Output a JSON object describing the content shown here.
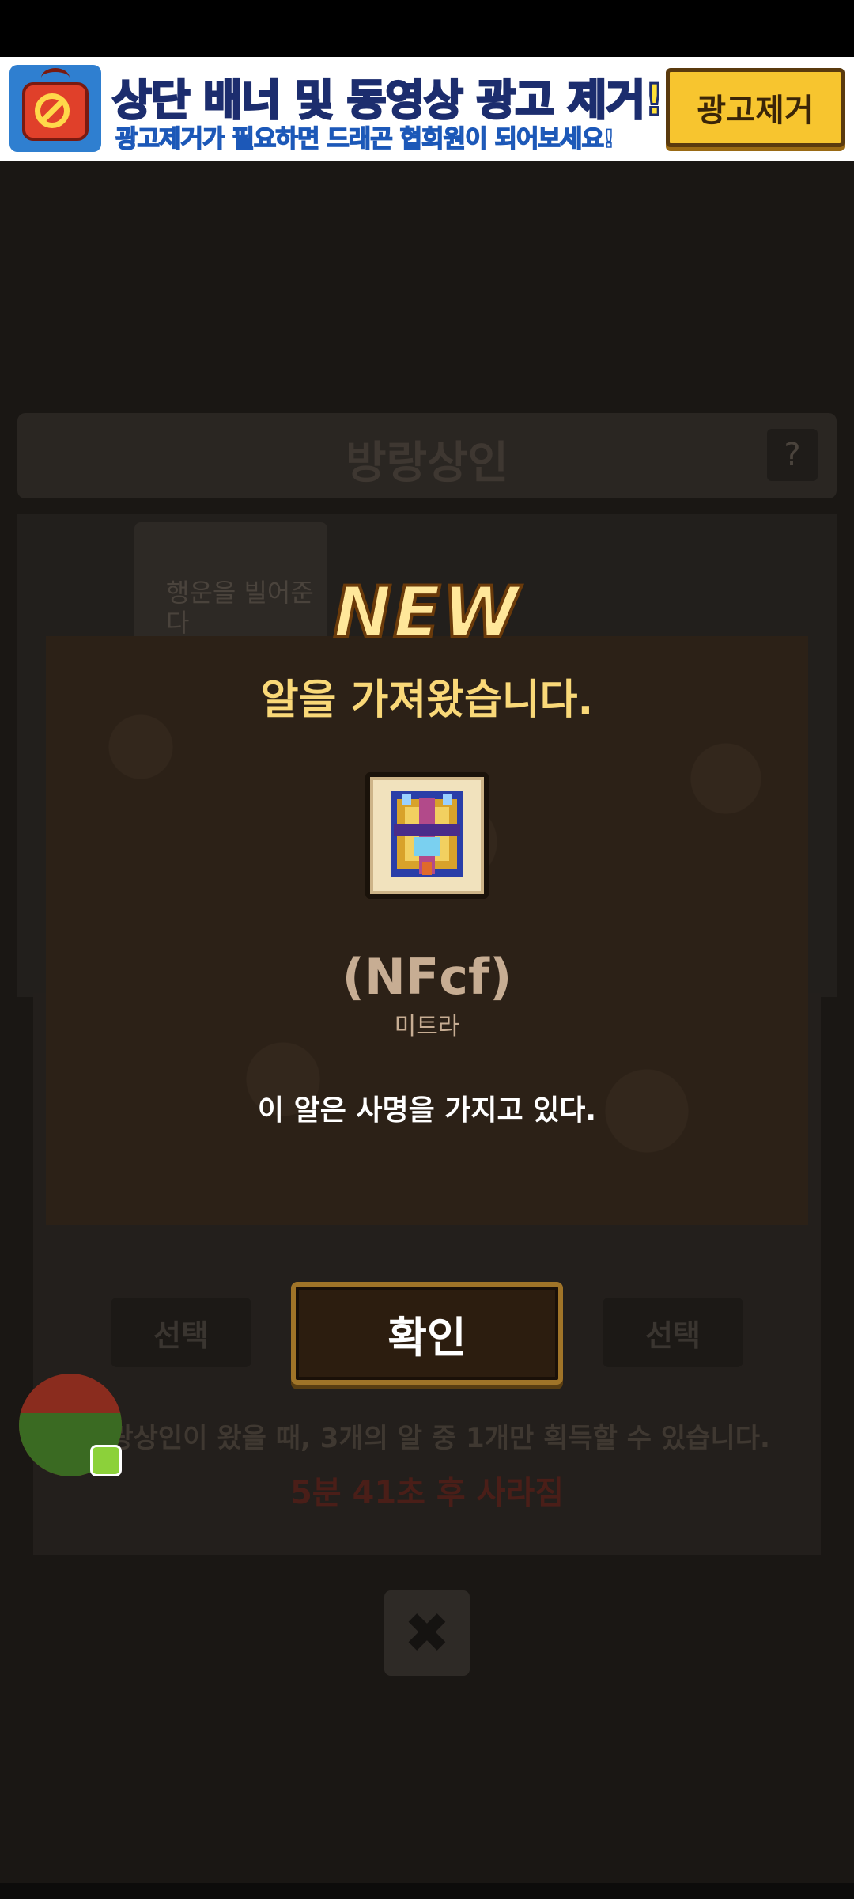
{
  "ad_banner": {
    "title": "상단 배너 및 동영상 광고 제거!",
    "subtitle": "광고제거가 필요하면 드래곤 협회원이 되어보세요!",
    "remove_button": "광고제거"
  },
  "background": {
    "header_title": "방랑상인",
    "help_label": "?",
    "card_text": "행운을 빌어준다",
    "select_left": "선택",
    "select_right": "선택",
    "info_text": "방랑상인이 왔을 때, 3개의 알 중 1개만 획득할 수 있습니다.",
    "timer_text": "5분 41초 후 사라짐",
    "close_label": "✖"
  },
  "modal": {
    "badge": "NEW",
    "title": "알을 가져왔습니다.",
    "item_icon": "egg-icon",
    "item_name": "(NFcf)",
    "item_subname": "미트라",
    "description": "이 알은 사명을 가지고 있다.",
    "confirm_label": "확인"
  },
  "colors": {
    "modal_bg": "#2c2117",
    "title": "#f9d878",
    "ad_button": "#f7c52f"
  }
}
